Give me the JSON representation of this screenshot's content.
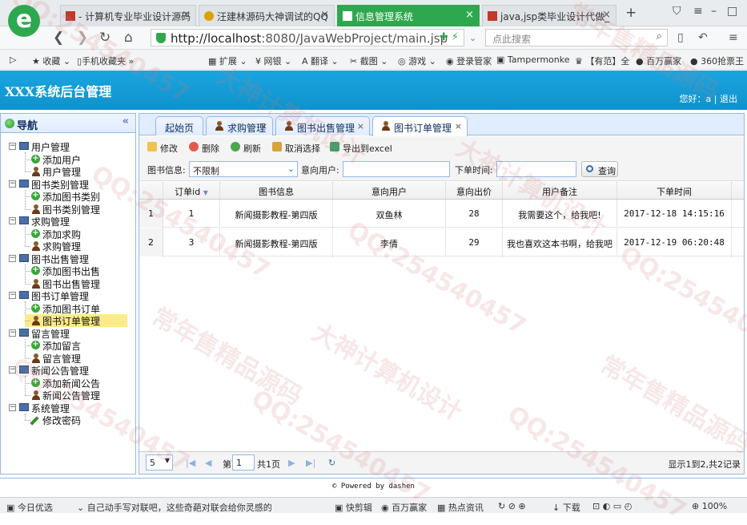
{
  "browser": {
    "tabs": [
      {
        "title": "- 计算机专业毕业设计源码"
      },
      {
        "title": "汪建林源码大神调试的QQ"
      },
      {
        "title": "信息管理系统"
      },
      {
        "title": "java,jsp类毕业设计代做_"
      }
    ],
    "new_tab": "+",
    "url_host": "http://localhost",
    "url_rest": ":8080/JavaWebProject/main.jsp",
    "search_placeholder": "点此搜索",
    "bookmarks": [
      "收藏",
      "手机收藏夹",
      "扩展",
      "网银",
      "翻译",
      "截图",
      "游戏",
      "登录管家",
      "Tampermonke",
      "【有范】全",
      "百万赢家",
      "360抢票王"
    ]
  },
  "app": {
    "title": "XXX系统后台管理",
    "greeting": "您好：a",
    "logout": "退出"
  },
  "sidebar": {
    "header": "导航",
    "groups": [
      {
        "label": "用户管理",
        "items": [
          "添加用户",
          "用户管理"
        ]
      },
      {
        "label": "图书类别管理",
        "items": [
          "添加图书类别",
          "图书类别管理"
        ]
      },
      {
        "label": "求购管理",
        "items": [
          "添加求购",
          "求购管理"
        ]
      },
      {
        "label": "图书出售管理",
        "items": [
          "添加图书出售",
          "图书出售管理"
        ]
      },
      {
        "label": "图书订单管理",
        "items": [
          "添加图书订单",
          "图书订单管理"
        ]
      },
      {
        "label": "留言管理",
        "items": [
          "添加留言",
          "留言管理"
        ]
      },
      {
        "label": "新闻公告管理",
        "items": [
          "添加新闻公告",
          "新闻公告管理"
        ]
      },
      {
        "label": "系统管理",
        "items": [
          "修改密码"
        ]
      }
    ]
  },
  "panel_tabs": [
    "起始页",
    "求购管理",
    "图书出售管理",
    "图书订单管理"
  ],
  "toolbar": {
    "edit": "修改",
    "delete": "删除",
    "refresh": "刷新",
    "deselect": "取消选择",
    "export": "导出到excel"
  },
  "search": {
    "book_label": "图书信息:",
    "book_value": "不限制",
    "user_label": "意向用户:",
    "time_label": "下单时间:",
    "query": "查询"
  },
  "grid": {
    "headers": [
      "订单id",
      "图书信息",
      "意向用户",
      "意向出价",
      "用户备注",
      "下单时间"
    ],
    "rows": [
      {
        "n": "1",
        "id": "1",
        "book": "新闻摄影教程-第四版",
        "user": "双鱼林",
        "price": "28",
        "note": "我需要这个，给我吧!",
        "time": "2017-12-18 14:15:16"
      },
      {
        "n": "2",
        "id": "3",
        "book": "新闻摄影教程-第四版",
        "user": "李倩",
        "price": "29",
        "note": "我也喜欢这本书啊，给我吧",
        "time": "2017-12-19 06:20:48"
      }
    ]
  },
  "pager": {
    "page_size": "5",
    "page_prefix": "第",
    "page_value": "1",
    "page_suffix": "共1页",
    "summary": "显示1到2,共2记录"
  },
  "footer": "© Powered by dashen",
  "statusbar": {
    "left": "今日优选",
    "news": "自己动手写对联吧，这些奇葩对联会给你灵感的",
    "quick": "快剪辑",
    "win": "百万赢家",
    "hot": "热点资讯",
    "download": "下载",
    "zoom": "100%"
  },
  "watermarks": [
    "QQ:254540457",
    "大神计算机设计",
    "常年售精品源码"
  ]
}
